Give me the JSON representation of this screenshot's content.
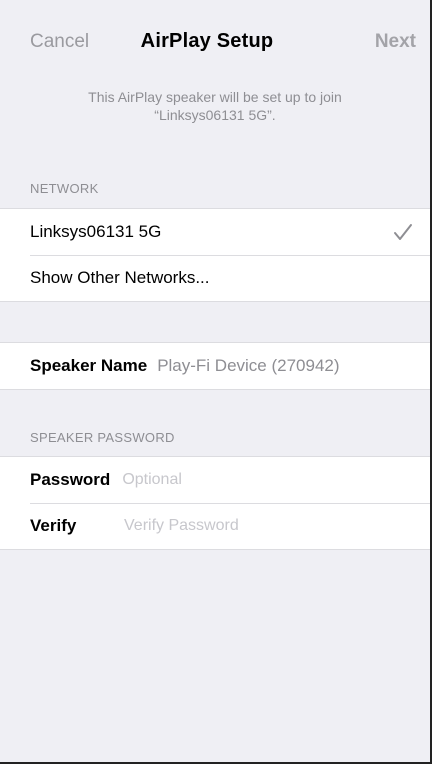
{
  "nav": {
    "cancel": "Cancel",
    "title": "AirPlay Setup",
    "next": "Next"
  },
  "subtitle": {
    "line1": "This AirPlay speaker will be set up to join",
    "line2": "“Linksys06131 5G”."
  },
  "network": {
    "header": "NETWORK",
    "selected": "Linksys06131 5G",
    "other": "Show Other Networks..."
  },
  "speaker": {
    "label": "Speaker Name",
    "value": "Play-Fi Device (270942)"
  },
  "password": {
    "header": "SPEAKER PASSWORD",
    "password_label": "Password",
    "password_placeholder": "Optional",
    "verify_label": "Verify",
    "verify_placeholder": "Verify Password"
  },
  "colors": {
    "background": "#efeff4",
    "secondary_text": "#8e8e93",
    "placeholder": "#c7c7cc"
  }
}
